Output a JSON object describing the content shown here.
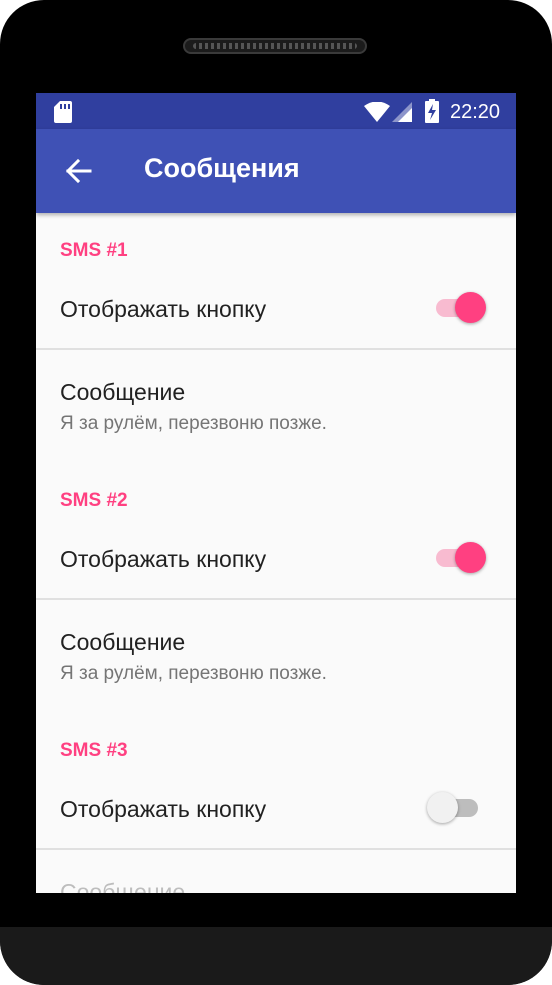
{
  "status_bar": {
    "time": "22:20",
    "icons": [
      "sd-card-icon",
      "wifi-icon",
      "signal-icon",
      "battery-charging-icon"
    ],
    "color": "#303f9f"
  },
  "app_bar": {
    "title": "Сообщения",
    "back_icon": "arrow-back-icon",
    "color": "#3f51b5"
  },
  "accent_color": "#ff4081",
  "sections": [
    {
      "header": "SMS #1",
      "toggle_label": "Отображать кнопку",
      "toggle_on": true,
      "message_label": "Сообщение",
      "message_value": "Я за рулём, перезвоню позже."
    },
    {
      "header": "SMS #2",
      "toggle_label": "Отображать кнопку",
      "toggle_on": true,
      "message_label": "Сообщение",
      "message_value": "Я за рулём, перезвоню позже."
    },
    {
      "header": "SMS #3",
      "toggle_label": "Отображать кнопку",
      "toggle_on": false,
      "message_label": "Сообщение"
    }
  ]
}
